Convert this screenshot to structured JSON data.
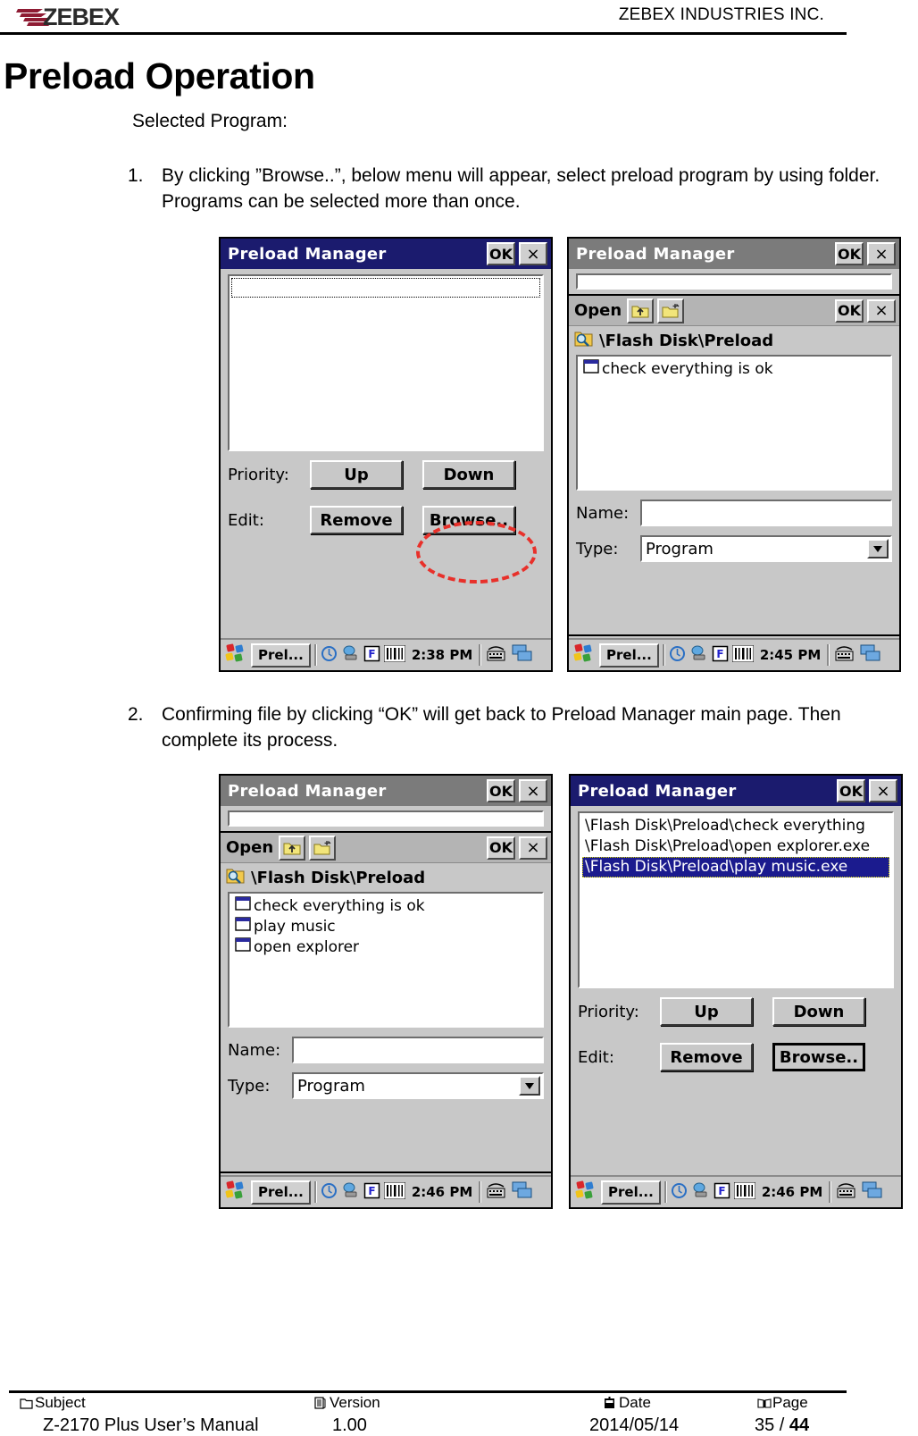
{
  "header": {
    "logo_text": "ZEBEX",
    "company": "ZEBEX INDUSTRIES INC."
  },
  "title": "Preload Operation",
  "body": {
    "intro": "Selected Program:",
    "steps": [
      {
        "number": "1.",
        "text": "By clicking ”Browse..”, below menu will appear, select preload program by using folder. Programs can be selected more than once."
      },
      {
        "number": "2.",
        "text": "Confirming file by clicking “OK” will get back to Preload Manager main page. Then complete its process."
      }
    ]
  },
  "screenshots": [
    {
      "id": "shot-1",
      "window_title": "Preload Manager",
      "titlebar_state": "active",
      "ok_label": "OK",
      "close_label": "×",
      "list_items": [],
      "priority_label": "Priority:",
      "up_label": "Up",
      "down_label": "Down",
      "edit_label": "Edit:",
      "remove_label": "Remove",
      "browse_label": "Browse..",
      "annotation": "red-dashed-ellipse-around-browse",
      "taskbar": {
        "task_button": "Prel...",
        "time": "2:38 PM"
      }
    },
    {
      "id": "shot-2",
      "window_title": "Preload Manager",
      "titlebar_state": "inactive",
      "ok_label": "OK",
      "close_label": "×",
      "dialog": {
        "open_label": "Open",
        "ok_label": "OK",
        "close_label": "×",
        "path": "\\Flash Disk\\Preload",
        "files": [
          "check everything is ok"
        ],
        "name_label": "Name:",
        "name_value": "",
        "type_label": "Type:",
        "type_value": "Program"
      },
      "taskbar": {
        "task_button": "Prel...",
        "time": "2:45 PM"
      }
    },
    {
      "id": "shot-3",
      "window_title": "Preload Manager",
      "titlebar_state": "inactive",
      "ok_label": "OK",
      "close_label": "×",
      "dialog": {
        "open_label": "Open",
        "ok_label": "OK",
        "close_label": "×",
        "path": "\\Flash Disk\\Preload",
        "files": [
          "check everything is ok",
          "play music",
          "open explorer"
        ],
        "name_label": "Name:",
        "name_value": "",
        "type_label": "Type:",
        "type_value": "Program"
      },
      "taskbar": {
        "task_button": "Prel...",
        "time": "2:46 PM"
      }
    },
    {
      "id": "shot-4",
      "window_title": "Preload Manager",
      "titlebar_state": "active",
      "ok_label": "OK",
      "close_label": "×",
      "list_items": [
        "\\Flash Disk\\Preload\\check everything",
        "\\Flash Disk\\Preload\\open explorer.exe",
        "\\Flash Disk\\Preload\\play music.exe"
      ],
      "selected_index": 2,
      "priority_label": "Priority:",
      "up_label": "Up",
      "down_label": "Down",
      "edit_label": "Edit:",
      "remove_label": "Remove",
      "browse_label": "Browse..",
      "taskbar": {
        "task_button": "Prel...",
        "time": "2:46 PM"
      }
    }
  ],
  "footer": {
    "columns": [
      {
        "head": "Subject",
        "value": "Z-2170 Plus User’s Manual"
      },
      {
        "head": "Version",
        "value": "1.00"
      },
      {
        "head": "Date",
        "value": "2014/05/14"
      },
      {
        "head": "Page",
        "value": "35 / ",
        "value_bold": "44"
      }
    ]
  },
  "colors": {
    "titlebar_active": "#1b1b6e",
    "titlebar_inactive": "#7b7b7b",
    "annotation_red": "#e8302a",
    "logo_red": "#8e1b33",
    "selection_blue": "#1b1b8e"
  }
}
